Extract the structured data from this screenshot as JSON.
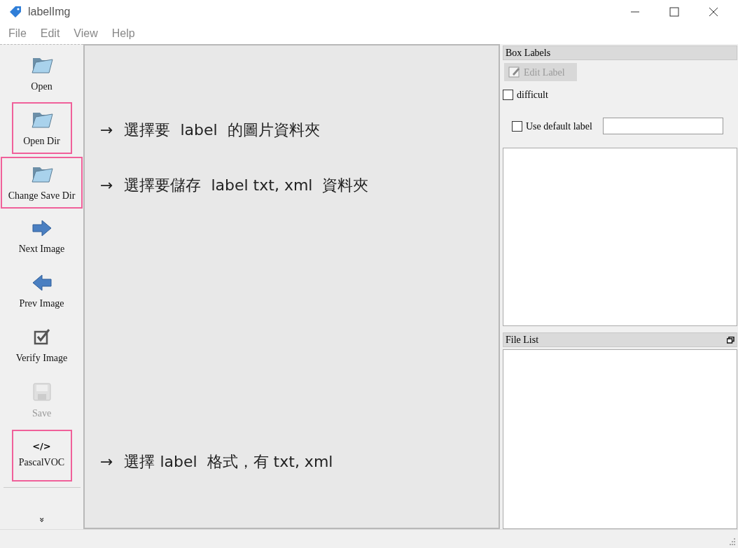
{
  "window": {
    "title": "labelImg"
  },
  "menu": [
    "File",
    "Edit",
    "View",
    "Help"
  ],
  "toolbar": [
    {
      "label": "Open",
      "kind": "folder",
      "highlighted": false,
      "disabled": false
    },
    {
      "label": "Open Dir",
      "kind": "folder",
      "highlighted": true,
      "disabled": false
    },
    {
      "label": "Change Save Dir",
      "kind": "folder",
      "highlighted": true,
      "disabled": false
    },
    {
      "label": "Next Image",
      "kind": "arrow-right",
      "highlighted": false,
      "disabled": false
    },
    {
      "label": "Prev Image",
      "kind": "arrow-left",
      "highlighted": false,
      "disabled": false
    },
    {
      "label": "Verify Image",
      "kind": "check",
      "highlighted": false,
      "disabled": false
    },
    {
      "label": "Save",
      "kind": "save",
      "highlighted": false,
      "disabled": true
    },
    {
      "label": "PascalVOC",
      "kind": "glyph",
      "glyph": "</>",
      "highlighted": true,
      "disabled": false
    }
  ],
  "toolbar_more": "»",
  "annotations_top": [
    {
      "arrow": "→",
      "text": "選擇要  label  的圖片資料夾"
    },
    {
      "arrow": "→",
      "text": "選擇要儲存  label txt, xml  資料夾"
    }
  ],
  "annotations_bottom": [
    {
      "arrow": "→",
      "text": "選擇 label  格式，有 txt, xml"
    }
  ],
  "box_labels": {
    "title": "Box Labels",
    "edit_button": {
      "label": "Edit Label",
      "disabled": true
    },
    "difficult": {
      "label": "difficult",
      "checked": false
    },
    "use_default": {
      "label": "Use default label",
      "checked": false
    }
  },
  "file_list": {
    "title": "File List"
  }
}
